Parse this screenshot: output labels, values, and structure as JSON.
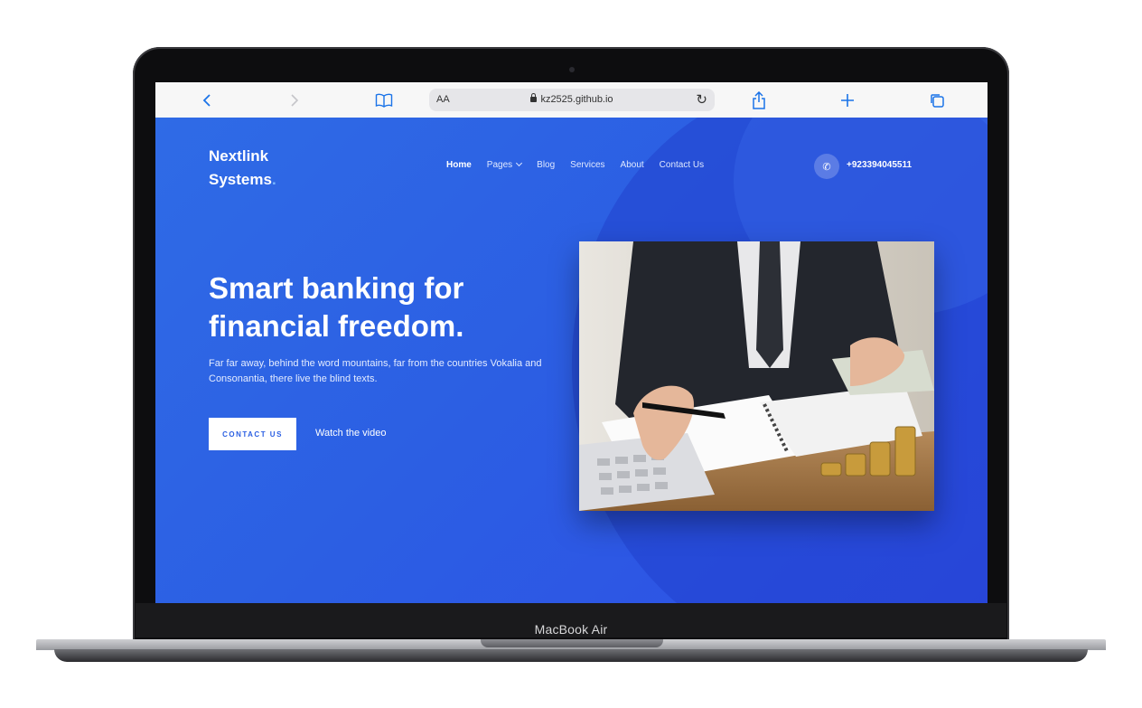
{
  "device": {
    "model_label": "MacBook Air"
  },
  "browser": {
    "text_size_label": "AA",
    "url": "kz2525.github.io"
  },
  "site": {
    "logo_line1": "Nextlink",
    "logo_line2": "Systems",
    "logo_dot": ".",
    "nav": [
      "Home",
      "Pages",
      "Blog",
      "Services",
      "About",
      "Contact Us"
    ],
    "phone": "+923394045511",
    "headline_line1": "Smart banking for",
    "headline_line2": "financial freedom.",
    "subtext": "Far far away, behind the word mountains, far from the countries Vokalia and Consonantia, there live the blind texts.",
    "cta_label": "CONTACT US",
    "watch_label": "Watch the video"
  },
  "colors": {
    "hero_blue": "#2c5fe3",
    "accent": "#1a73e8"
  },
  "icons": {
    "back": "chevron-left-icon",
    "forward": "chevron-right-icon",
    "bookmarks": "book-icon",
    "share": "share-icon",
    "new_tab": "plus-icon",
    "tabs": "tabs-icon",
    "reload": "reload-icon",
    "phone": "phone-icon"
  }
}
